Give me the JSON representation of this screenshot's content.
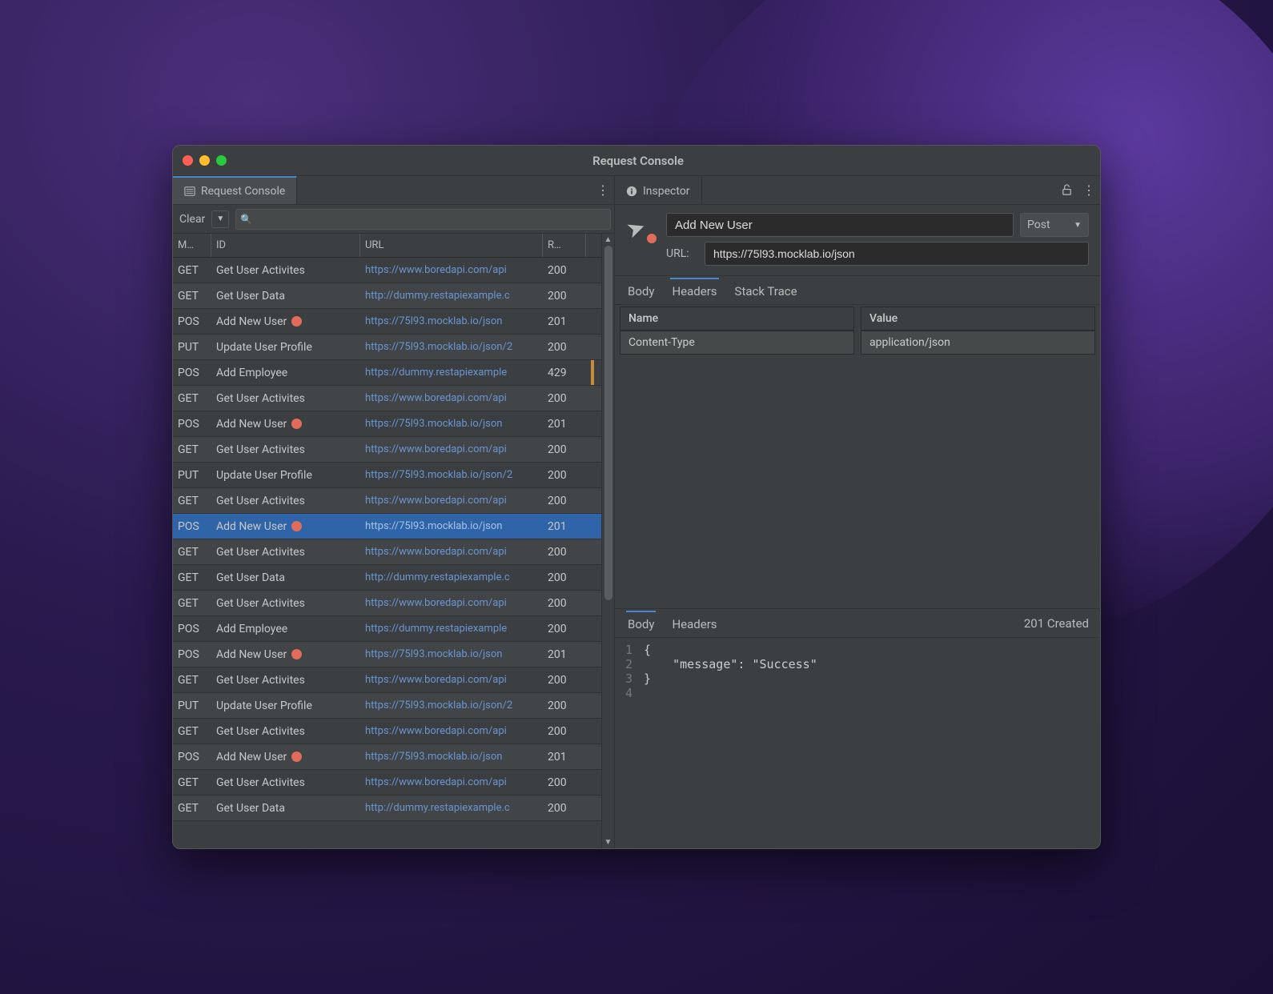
{
  "window": {
    "title": "Request Console"
  },
  "leftTab": {
    "label": "Request Console"
  },
  "toolbar": {
    "clear": "Clear"
  },
  "columns": {
    "m": "M…",
    "id": "ID",
    "url": "URL",
    "r": "R…"
  },
  "rows": [
    {
      "m": "GET",
      "id": "Get User Activites",
      "url": "https://www.boredapi.com/api",
      "r": "200",
      "dot": false,
      "selected": false
    },
    {
      "m": "GET",
      "id": "Get User Data",
      "url": "http://dummy.restapiexample.c",
      "r": "200",
      "dot": false,
      "selected": false
    },
    {
      "m": "POS",
      "id": "Add New User",
      "url": "https://75l93.mocklab.io/json",
      "r": "201",
      "dot": true,
      "selected": false
    },
    {
      "m": "PUT",
      "id": "Update User Profile",
      "url": "https://75l93.mocklab.io/json/2",
      "r": "200",
      "dot": false,
      "selected": false
    },
    {
      "m": "POS",
      "id": "Add Employee",
      "url": "https://dummy.restapiexample",
      "r": "429",
      "dot": false,
      "selected": false,
      "warn": true
    },
    {
      "m": "GET",
      "id": "Get User Activites",
      "url": "https://www.boredapi.com/api",
      "r": "200",
      "dot": false,
      "selected": false
    },
    {
      "m": "POS",
      "id": "Add New User",
      "url": "https://75l93.mocklab.io/json",
      "r": "201",
      "dot": true,
      "selected": false
    },
    {
      "m": "GET",
      "id": "Get User Activites",
      "url": "https://www.boredapi.com/api",
      "r": "200",
      "dot": false,
      "selected": false
    },
    {
      "m": "PUT",
      "id": "Update User Profile",
      "url": "https://75l93.mocklab.io/json/2",
      "r": "200",
      "dot": false,
      "selected": false
    },
    {
      "m": "GET",
      "id": "Get User Activites",
      "url": "https://www.boredapi.com/api",
      "r": "200",
      "dot": false,
      "selected": false
    },
    {
      "m": "POS",
      "id": "Add New User",
      "url": "https://75l93.mocklab.io/json",
      "r": "201",
      "dot": true,
      "selected": true
    },
    {
      "m": "GET",
      "id": "Get User Activites",
      "url": "https://www.boredapi.com/api",
      "r": "200",
      "dot": false,
      "selected": false
    },
    {
      "m": "GET",
      "id": "Get User Data",
      "url": "http://dummy.restapiexample.c",
      "r": "200",
      "dot": false,
      "selected": false
    },
    {
      "m": "GET",
      "id": "Get User Activites",
      "url": "https://www.boredapi.com/api",
      "r": "200",
      "dot": false,
      "selected": false
    },
    {
      "m": "POS",
      "id": "Add Employee",
      "url": "https://dummy.restapiexample",
      "r": "200",
      "dot": false,
      "selected": false
    },
    {
      "m": "POS",
      "id": "Add New User",
      "url": "https://75l93.mocklab.io/json",
      "r": "201",
      "dot": true,
      "selected": false
    },
    {
      "m": "GET",
      "id": "Get User Activites",
      "url": "https://www.boredapi.com/api",
      "r": "200",
      "dot": false,
      "selected": false
    },
    {
      "m": "PUT",
      "id": "Update User Profile",
      "url": "https://75l93.mocklab.io/json/2",
      "r": "200",
      "dot": false,
      "selected": false
    },
    {
      "m": "GET",
      "id": "Get User Activites",
      "url": "https://www.boredapi.com/api",
      "r": "200",
      "dot": false,
      "selected": false
    },
    {
      "m": "POS",
      "id": "Add New User",
      "url": "https://75l93.mocklab.io/json",
      "r": "201",
      "dot": true,
      "selected": false
    },
    {
      "m": "GET",
      "id": "Get User Activites",
      "url": "https://www.boredapi.com/api",
      "r": "200",
      "dot": false,
      "selected": false
    },
    {
      "m": "GET",
      "id": "Get User Data",
      "url": "http://dummy.restapiexample.c",
      "r": "200",
      "dot": false,
      "selected": false
    }
  ],
  "inspector": {
    "tabLabel": "Inspector",
    "name": "Add New User",
    "method": "Post",
    "urlLabel": "URL:",
    "url": "https://75l93.mocklab.io/json",
    "reqTabs": {
      "body": "Body",
      "headers": "Headers",
      "stack": "Stack Trace",
      "active": "headers"
    },
    "headers": {
      "colName": "Name",
      "colValue": "Value",
      "rows": [
        {
          "name": "Content-Type",
          "value": "application/json"
        }
      ]
    },
    "respTabs": {
      "body": "Body",
      "headers": "Headers",
      "active": "body"
    },
    "status": "201 Created",
    "responseLines": [
      "{",
      "    \"message\": \"Success\"",
      "}",
      ""
    ]
  }
}
